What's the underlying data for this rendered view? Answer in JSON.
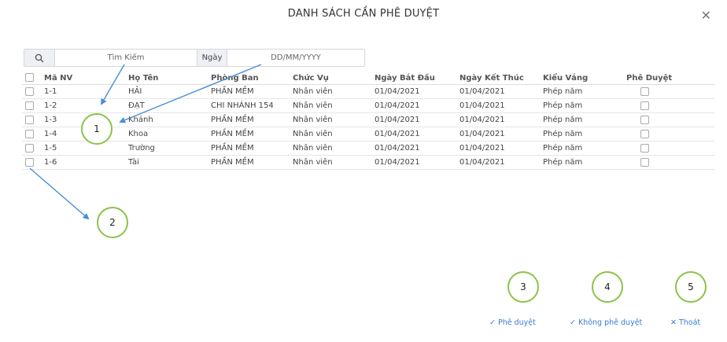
{
  "dialog": {
    "title": "DANH SÁCH CẦN PHÊ DUYỆT"
  },
  "search": {
    "placeholder": "Tìm Kiếm",
    "date_label": "Ngày",
    "date_placeholder": "DD/MM/YYYY"
  },
  "table": {
    "headers": [
      "Mã NV",
      "Họ Tên",
      "Phòng Ban",
      "Chức Vụ",
      "Ngày Bắt Đầu",
      "Ngày Kết Thúc",
      "Kiểu Vắng",
      "Phê Duyệt"
    ],
    "rows": [
      [
        "1-1",
        "HẢI",
        "PHẦN MỀM",
        "Nhân viên",
        "01/04/2021",
        "01/04/2021",
        "Phép năm"
      ],
      [
        "1-2",
        "ĐẠT",
        "CHI NHÁNH 154",
        "Nhân viên",
        "01/04/2021",
        "01/04/2021",
        "Phép năm"
      ],
      [
        "1-3",
        "Khánh",
        "PHẦN MỀM",
        "Nhân viên",
        "01/04/2021",
        "01/04/2021",
        "Phép năm"
      ],
      [
        "1-4",
        "Khoa",
        "PHẦN MỀM",
        "Nhân viên",
        "01/04/2021",
        "01/04/2021",
        "Phép năm"
      ],
      [
        "1-5",
        "Trường",
        "PHẦN MỀM",
        "Nhân viên",
        "01/04/2021",
        "01/04/2021",
        "Phép năm"
      ],
      [
        "1-6",
        "Tài",
        "PHẦN MỀM",
        "Nhân viên",
        "01/04/2021",
        "01/04/2021",
        "Phép năm"
      ]
    ]
  },
  "annotations": [
    "1",
    "2",
    "3",
    "4",
    "5"
  ],
  "actions": {
    "approve": "Phê duyệt",
    "reject": "Không phê duyệt",
    "exit": "Thoát"
  },
  "colors": {
    "accent": "#3a7bd5",
    "annotation_circle": "#8bc34a",
    "arrow": "#4a8fd6"
  }
}
